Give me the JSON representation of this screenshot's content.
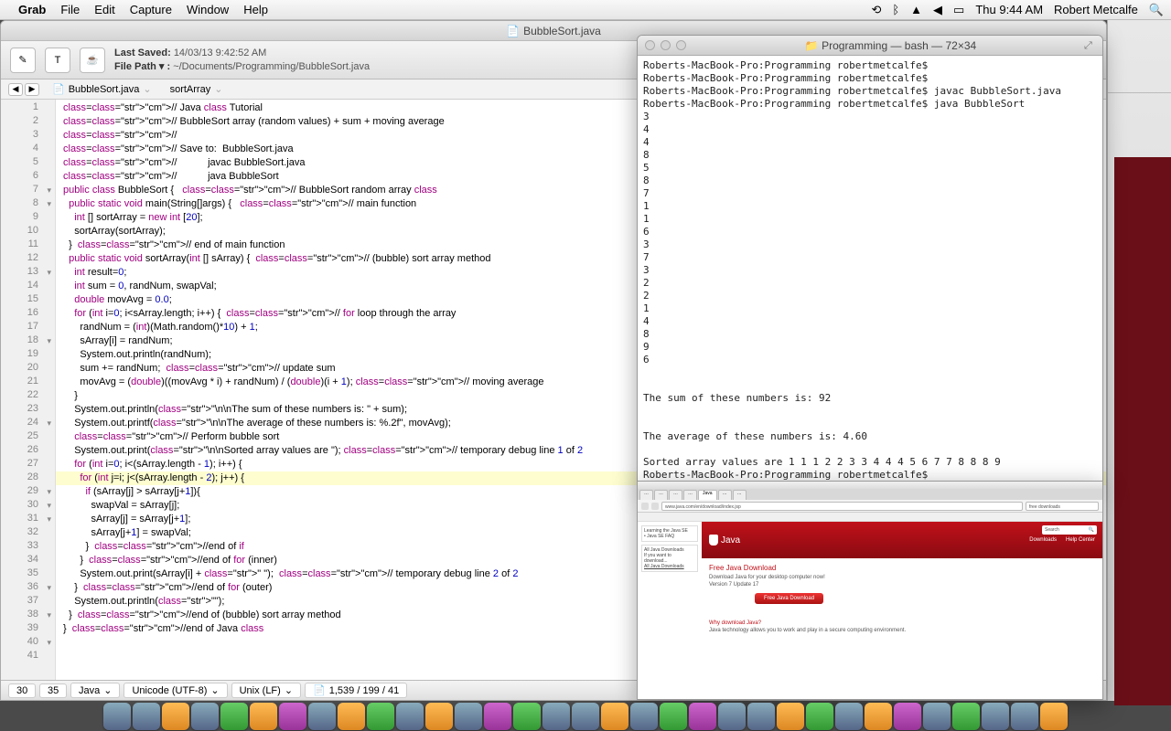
{
  "menubar": {
    "app": "Grab",
    "items": [
      "File",
      "Edit",
      "Capture",
      "Window",
      "Help"
    ],
    "clock": "Thu 9:44 AM",
    "user": "Robert Metcalfe"
  },
  "editor": {
    "title": "BubbleSort.java",
    "saved_lbl": "Last Saved:",
    "saved_val": "14/03/13 9:42:52 AM",
    "path_lbl": "File Path ▾ :",
    "path_val": "~/Documents/Programming/BubbleSort.java",
    "crumb_file": "BubbleSort.java",
    "crumb_fn": "sortArray",
    "status": {
      "row": "30",
      "col": "35",
      "lang": "Java",
      "enc": "Unicode (UTF-8)",
      "le": "Unix (LF)",
      "stats": "1,539 / 199 / 41"
    }
  },
  "code_lines": [
    "// Java class Tutorial",
    "// BubbleSort array (random values) + sum + moving average",
    "//",
    "// Save to:  BubbleSort.java",
    "//           javac BubbleSort.java",
    "//           java BubbleSort",
    "public class BubbleSort {   // BubbleSort random array class",
    "  public static void main(String[]args) {   // main function",
    "    int [] sortArray = new int [20];",
    "    sortArray(sortArray);",
    "  }  // end of main function",
    "",
    "  public static void sortArray(int [] sArray) {  // (bubble) sort array method",
    "    int result=0;",
    "    int sum = 0, randNum, swapVal;",
    "    double movAvg = 0.0;",
    "",
    "    for (int i=0; i<sArray.length; i++) {  // for loop through the array",
    "      randNum = (int)(Math.random()*10) + 1;",
    "      sArray[i] = randNum;",
    "      System.out.println(randNum);",
    "      sum += randNum;  // update sum",
    "      movAvg = (double)((movAvg * i) + randNum) / (double)(i + 1); // moving average",
    "    }",
    "    System.out.println(\"\\n\\nThe sum of these numbers is: \" + sum);",
    "    System.out.printf(\"\\n\\nThe average of these numbers is: %.2f\", movAvg);",
    "    // Perform bubble sort",
    "    System.out.print(\"\\n\\nSorted array values are \"); // temporary debug line 1 of 2",
    "    for (int i=0; i<(sArray.length - 1); i++) {",
    "      for (int j=i; j<(sArray.length - 2); j++) {",
    "        if (sArray[j] > sArray[j+1]){",
    "          swapVal = sArray[j];",
    "          sArray[j] = sArray[j+1];",
    "          sArray[j+1] = swapVal;",
    "        }  //end of if",
    "      }  //end of for (inner)",
    "      System.out.print(sArray[i] + \" \");  // temporary debug line 2 of 2",
    "    }  //end of for (outer)",
    "    System.out.println(\"\");",
    "  }  //end of (bubble) sort array method",
    "}  //end of Java class"
  ],
  "folds": [
    7,
    8,
    13,
    18,
    24,
    29,
    30,
    31,
    36,
    38,
    40
  ],
  "terminal": {
    "title": "Programming — bash — 72×34",
    "lines": [
      "Roberts-MacBook-Pro:Programming robertmetcalfe$",
      "Roberts-MacBook-Pro:Programming robertmetcalfe$",
      "Roberts-MacBook-Pro:Programming robertmetcalfe$ javac BubbleSort.java",
      "Roberts-MacBook-Pro:Programming robertmetcalfe$ java BubbleSort",
      "3",
      "4",
      "4",
      "8",
      "5",
      "8",
      "7",
      "1",
      "1",
      "6",
      "3",
      "7",
      "3",
      "2",
      "2",
      "1",
      "4",
      "8",
      "9",
      "6",
      "",
      "",
      "The sum of these numbers is: 92",
      "",
      "",
      "The average of these numbers is: 4.60",
      "",
      "Sorted array values are 1 1 1 2 2 3 3 4 4 4 5 6 7 7 8 8 8 9",
      "Roberts-MacBook-Pro:Programming robertmetcalfe$"
    ]
  },
  "browser": {
    "addr": "www.java.com/en/download/index.jsp",
    "search_ph": "free downloads",
    "hero_search": "Search",
    "logo": "Java",
    "nav": [
      "Downloads",
      "Help Center"
    ],
    "h2": "Free Java Download",
    "p1": "Download Java for your desktop computer now!",
    "p2": "Version 7 Update 17",
    "dl": "Free Java Download",
    "h3": "Why download Java?",
    "p3": "Java technology allows you to work and play in a secure computing environment."
  }
}
